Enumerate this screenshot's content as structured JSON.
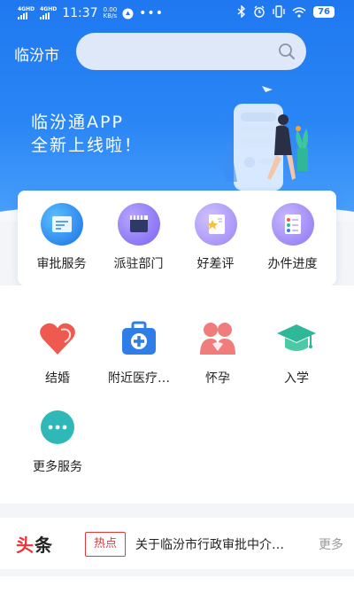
{
  "status_bar": {
    "network_a": "4GHD",
    "network_b": "4GHD",
    "time": "11:37",
    "speed_value": "0.00",
    "speed_unit": "KB/s",
    "battery": "76"
  },
  "header": {
    "city": "临汾市",
    "search_placeholder": ""
  },
  "banner": {
    "line1": "临汾通APP",
    "line2": "全新上线啦！"
  },
  "quick_actions": [
    {
      "label": "审批服务",
      "icon": "approval-icon"
    },
    {
      "label": "派驻部门",
      "icon": "department-icon"
    },
    {
      "label": "好差评",
      "icon": "rating-icon"
    },
    {
      "label": "办件进度",
      "icon": "progress-icon"
    }
  ],
  "services": [
    {
      "label": "结婚",
      "icon": "heart-icon"
    },
    {
      "label": "附近医疗…",
      "icon": "medical-kit-icon"
    },
    {
      "label": "怀孕",
      "icon": "pregnancy-icon"
    },
    {
      "label": "入学",
      "icon": "graduation-cap-icon"
    },
    {
      "label": "更多服务",
      "icon": "more-icon"
    }
  ],
  "news": {
    "brand_a": "头",
    "brand_b": "条",
    "tag": "热点",
    "headline": "关于临汾市行政审批中介…",
    "more": "更多"
  },
  "colors": {
    "primary": "#1f78f0",
    "hot_red": "#e8353a",
    "marriage": "#ef5a50",
    "medical": "#2f7ee8",
    "pregnancy": "#f07c7c",
    "school": "#2fb79a",
    "more": "#2fb8b8"
  }
}
